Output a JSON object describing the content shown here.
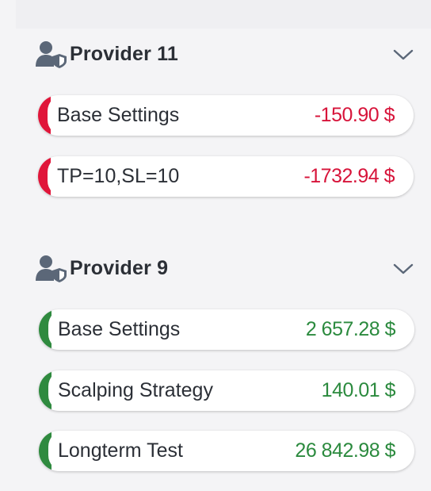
{
  "colors": {
    "negative": "#d7143a",
    "positive": "#2b8a3e",
    "icon": "#5b6778"
  },
  "groups": [
    {
      "name": "Provider 11",
      "icon": "user-shield-icon",
      "toggle_icon": "chevron-down-icon",
      "items": [
        {
          "label": "Base Settings",
          "amount": "-150.90 $",
          "status": "negative"
        },
        {
          "label": "TP=10,SL=10",
          "amount": "-1732.94 $",
          "status": "negative"
        }
      ]
    },
    {
      "name": "Provider 9",
      "icon": "user-shield-icon",
      "toggle_icon": "chevron-down-icon",
      "items": [
        {
          "label": "Base Settings",
          "amount": "2 657.28 $",
          "status": "positive"
        },
        {
          "label": "Scalping Strategy",
          "amount": "140.01 $",
          "status": "positive"
        },
        {
          "label": "Longterm Test",
          "amount": "26 842.98 $",
          "status": "positive"
        }
      ]
    }
  ]
}
